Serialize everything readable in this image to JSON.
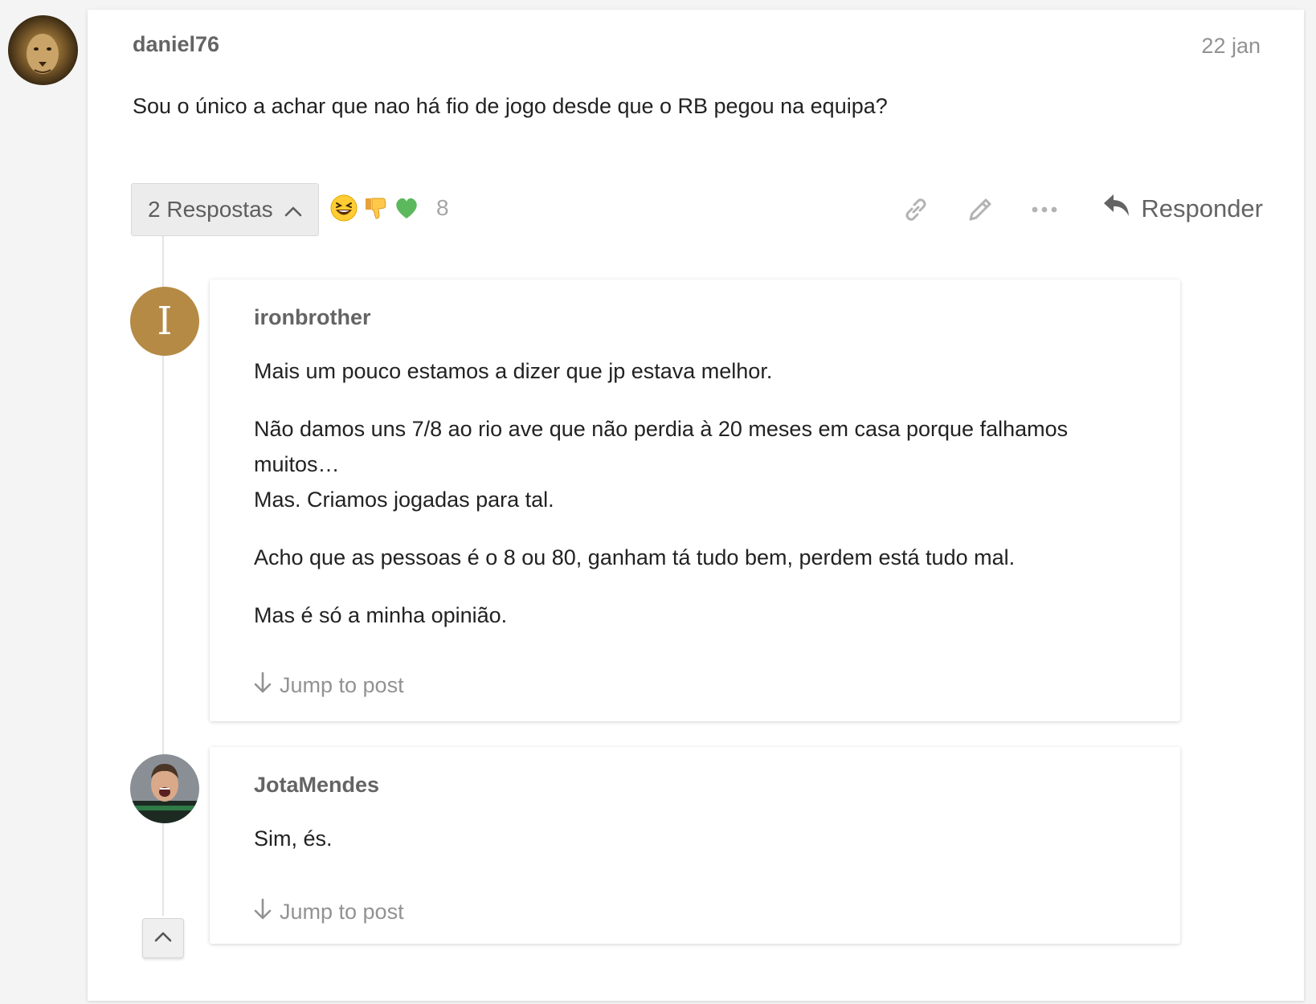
{
  "post": {
    "author": "daniel76",
    "date": "22 jan",
    "body": "Sou o único a achar que nao há fio de jogo desde que o RB pegou na equipa?",
    "avatar_icon": "lion-avatar"
  },
  "actions": {
    "replies_label": "2 Respostas",
    "reactions": [
      "laughing-emoji",
      "thumbs-down-emoji",
      "green-heart-emoji"
    ],
    "reaction_count": "8",
    "reply_label": "Responder",
    "icons": [
      "link-icon",
      "pencil-icon",
      "more-icon",
      "reply-arrow-icon"
    ]
  },
  "replies": [
    {
      "author": "ironbrother",
      "avatar_letter": "I",
      "avatar_color": "#b58a45",
      "paragraphs": [
        "Mais um pouco estamos a dizer que jp estava melhor.",
        "Não damos uns 7/8 ao rio ave que não perdia à 20 meses em casa porque falhamos muitos…",
        "Mas. Criamos jogadas para tal.",
        "Acho que as pessoas é o 8 ou 80, ganham tá tudo bem, perdem está tudo mal.",
        "Mas é só a minha opinião."
      ],
      "jump_label": "Jump to post"
    },
    {
      "author": "JotaMendes",
      "avatar_icon": "player-photo-avatar",
      "paragraphs": [
        "Sim, és."
      ],
      "jump_label": "Jump to post"
    }
  ],
  "colors": {
    "background": "#f4f4f4",
    "card": "#ffffff",
    "username": "#646464",
    "muted": "#929292",
    "heart": "#5cb85c"
  }
}
